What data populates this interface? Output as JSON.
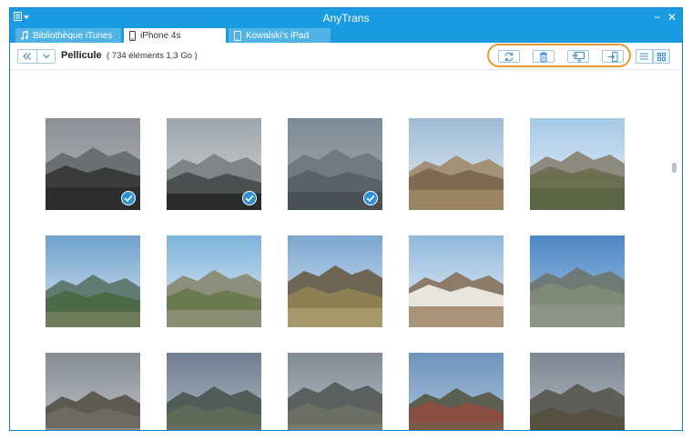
{
  "app": {
    "title": "AnyTrans"
  },
  "window_controls": {
    "minimize": "−",
    "close": "✕"
  },
  "tabs": [
    {
      "label": "Bibliothèque iTunes",
      "icon": "music-note-icon",
      "active": false
    },
    {
      "label": "iPhone 4s",
      "icon": "iphone-icon",
      "active": true
    },
    {
      "label": "Kowalski's iPad",
      "icon": "ipad-icon",
      "active": false
    }
  ],
  "toolbar": {
    "section_title": "Pellicule",
    "count_text": "( 734 éléments 1,3 Go )",
    "actions": [
      {
        "name": "refresh-button",
        "icon": "refresh-icon"
      },
      {
        "name": "delete-button",
        "icon": "trash-icon"
      },
      {
        "name": "to-computer-button",
        "icon": "to-computer-icon"
      },
      {
        "name": "to-device-button",
        "icon": "to-device-icon"
      }
    ],
    "views": [
      {
        "name": "list-view-button",
        "icon": "list-icon",
        "active": false
      },
      {
        "name": "grid-view-button",
        "icon": "grid-icon",
        "active": true
      }
    ]
  },
  "colors": {
    "accent": "#1a9ae0",
    "highlight": "#e89a2f",
    "check": "#2f8fd6"
  },
  "photos": [
    {
      "name": "photo-1",
      "selected": true,
      "sky": "#8c9096",
      "sky2": "#b5b8bb",
      "far": "#6c6f72",
      "near": "#3a3c3c",
      "ground": "#2c2d2d"
    },
    {
      "name": "photo-2",
      "selected": true,
      "sky": "#9fa6ab",
      "sky2": "#d0d4d6",
      "far": "#7f8486",
      "near": "#4b4f50",
      "ground": "#2a2b2b"
    },
    {
      "name": "photo-3",
      "selected": true,
      "sky": "#7d8b96",
      "sky2": "#a3adb4",
      "far": "#6f7a82",
      "near": "#596269",
      "ground": "#4a5156"
    },
    {
      "name": "photo-4",
      "selected": false,
      "sky": "#9ebcd6",
      "sky2": "#e2ebf2",
      "far": "#a39079",
      "near": "#7e6a52",
      "ground": "#9a8462"
    },
    {
      "name": "photo-5",
      "selected": false,
      "sky": "#a6c8e6",
      "sky2": "#e9f1f8",
      "far": "#8e8a7d",
      "near": "#6d6f52",
      "ground": "#5b6443"
    },
    {
      "name": "photo-6",
      "selected": false,
      "sky": "#6fa2cc",
      "sky2": "#d9e7f2",
      "far": "#617a74",
      "near": "#4c6a48",
      "ground": "#6f7e5a"
    },
    {
      "name": "photo-7",
      "selected": false,
      "sky": "#7eb3da",
      "sky2": "#e6eef5",
      "far": "#8b8f7c",
      "near": "#6c7a50",
      "ground": "#8a8c74"
    },
    {
      "name": "photo-8",
      "selected": false,
      "sky": "#7ba6d0",
      "sky2": "#dbe7f1",
      "far": "#6e6555",
      "near": "#8d8153",
      "ground": "#a69a6b"
    },
    {
      "name": "photo-9",
      "selected": false,
      "sky": "#8fb8dc",
      "sky2": "#ecf2f7",
      "far": "#8a7c68",
      "near": "#e9e4de",
      "ground": "#a99479"
    },
    {
      "name": "photo-10",
      "selected": false,
      "sky": "#4c86c4",
      "sky2": "#a9c8e4",
      "far": "#6d7a78",
      "near": "#7d8a75",
      "ground": "#8c9486"
    },
    {
      "name": "photo-11",
      "selected": false,
      "sky": "#858b93",
      "sky2": "#c8ccd0",
      "far": "#5e5a52",
      "near": "#6d6a61",
      "ground": "#8d8a82"
    },
    {
      "name": "photo-12",
      "selected": false,
      "sky": "#6e7f92",
      "sky2": "#b8c0c8",
      "far": "#4f5c57",
      "near": "#5f6a57",
      "ground": "#6a6f64"
    },
    {
      "name": "photo-13",
      "selected": false,
      "sky": "#7f8a95",
      "sky2": "#c4c9ce",
      "far": "#5a5f5f",
      "near": "#6b6e63",
      "ground": "#7a7a6d"
    },
    {
      "name": "photo-14",
      "selected": false,
      "sky": "#6d93bc",
      "sky2": "#b8cde1",
      "far": "#5b5f50",
      "near": "#8a4f42",
      "ground": "#7a5b4b"
    },
    {
      "name": "photo-15",
      "selected": false,
      "sky": "#7b8793",
      "sky2": "#bcc3ca",
      "far": "#5e5e58",
      "near": "#55503f",
      "ground": "#4e4838"
    }
  ]
}
